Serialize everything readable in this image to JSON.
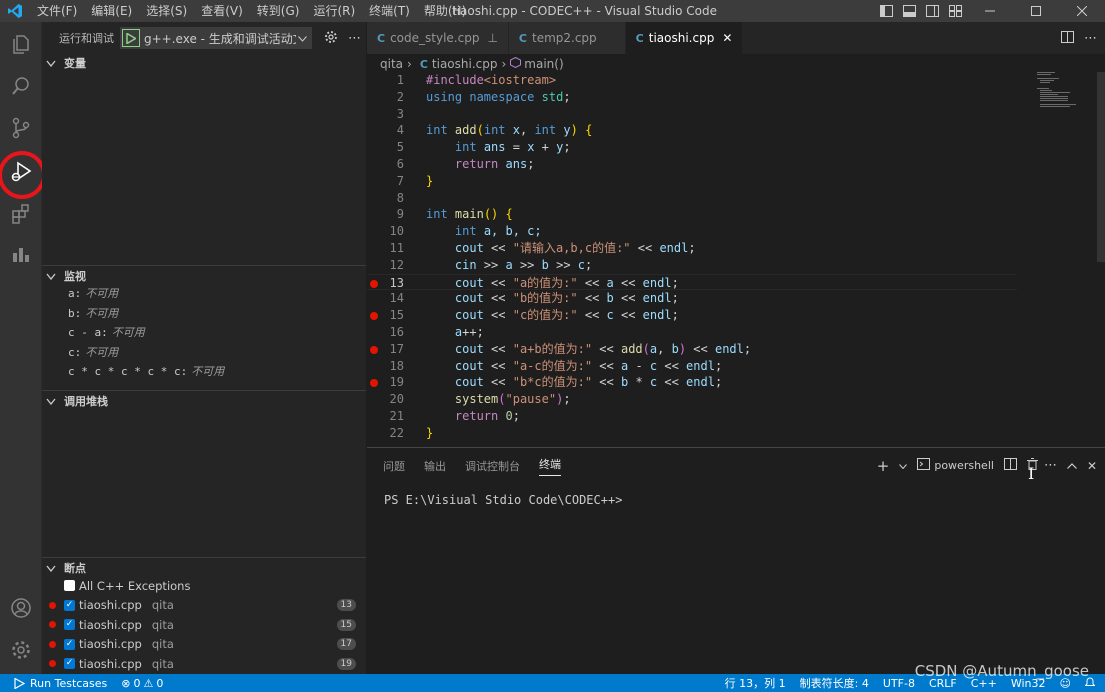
{
  "titlebar": {
    "menu": [
      "文件(F)",
      "编辑(E)",
      "选择(S)",
      "查看(V)",
      "转到(G)",
      "运行(R)",
      "终端(T)",
      "帮助(H)"
    ],
    "title": "tiaoshi.cpp - CODEC++ - Visual Studio Code"
  },
  "sidebar": {
    "header_label": "运行和调试",
    "launch_config": "g++.exe - 生成和调试活动文件",
    "variables_title": "变量",
    "watch_title": "监视",
    "watch": [
      {
        "expr": "a:",
        "value": "不可用"
      },
      {
        "expr": "b:",
        "value": "不可用"
      },
      {
        "expr": "c - a:",
        "value": "不可用"
      },
      {
        "expr": "c:",
        "value": "不可用"
      },
      {
        "expr": "c * c * c * c * c:",
        "value": "不可用"
      }
    ],
    "callstack_title": "调用堆栈",
    "breakpoints_title": "断点",
    "exceptions_label": "All C++ Exceptions",
    "breakpoints": [
      {
        "file": "tiaoshi.cpp",
        "path": "qita",
        "line": "13"
      },
      {
        "file": "tiaoshi.cpp",
        "path": "qita",
        "line": "15"
      },
      {
        "file": "tiaoshi.cpp",
        "path": "qita",
        "line": "17"
      },
      {
        "file": "tiaoshi.cpp",
        "path": "qita",
        "line": "19"
      }
    ]
  },
  "tabs": [
    {
      "label": "code_style.cpp",
      "active": false
    },
    {
      "label": "temp2.cpp",
      "active": false
    },
    {
      "label": "tiaoshi.cpp",
      "active": true
    }
  ],
  "breadcrumb": {
    "folder": "qita",
    "file": "tiaoshi.cpp",
    "symbol": "main()"
  },
  "editor": {
    "lines": [
      "1",
      "2",
      "3",
      "4",
      "5",
      "6",
      "7",
      "8",
      "9",
      "10",
      "11",
      "12",
      "13",
      "14",
      "15",
      "16",
      "17",
      "18",
      "19",
      "20",
      "21",
      "22"
    ],
    "code": {
      "l1a": "#include",
      "l1b": "<iostream>",
      "l2a": "using",
      "l2b": "namespace",
      "l2c": "std",
      "l4a": "int",
      "l4b": "add",
      "l4c": "int",
      "l4d": "x",
      "l4e": "int",
      "l4f": "y",
      "l5a": "int",
      "l5b": "ans",
      "l5c": "x",
      "l5d": "y",
      "l6a": "return",
      "l6b": "ans",
      "l9a": "int",
      "l9b": "main",
      "l10a": "int",
      "l10b": "a, b, c;",
      "l11a": "cout",
      "l11b": "\"请输入a,b,c的值:\"",
      "l11c": "endl",
      "l12a": "cin",
      "l12b": "a",
      "l12c": "b",
      "l12d": "c",
      "l13a": "cout",
      "l13b": "\"a的值为:\"",
      "l13c": "a",
      "l13d": "endl",
      "l14a": "cout",
      "l14b": "\"b的值为:\"",
      "l14c": "b",
      "l14d": "endl",
      "l15a": "cout",
      "l15b": "\"c的值为:\"",
      "l15c": "c",
      "l15d": "endl",
      "l16a": "a",
      "l17a": "cout",
      "l17b": "\"a+b的值为:\"",
      "l17c": "add",
      "l17d": "a",
      "l17e": "b",
      "l17f": "endl",
      "l18a": "cout",
      "l18b": "\"a-c的值为:\"",
      "l18c": "a",
      "l18d": "c",
      "l18e": "endl",
      "l19a": "cout",
      "l19b": "\"b*c的值为:\"",
      "l19c": "b",
      "l19d": "c",
      "l19e": "endl",
      "l20a": "system",
      "l20b": "\"pause\"",
      "l21a": "return",
      "l21b": "0"
    }
  },
  "panel": {
    "tabs": [
      "问题",
      "输出",
      "调试控制台",
      "终端"
    ],
    "shell": "powershell",
    "terminal_text": "PS E:\\Visiual Stdio Code\\CODEC++>"
  },
  "statusbar": {
    "run_testcases": "Run Testcases",
    "errors": "0",
    "warnings": "0",
    "position": "行 13，列 1",
    "tab_size": "制表符长度: 4",
    "encoding": "UTF-8",
    "eol": "CRLF",
    "language": "C++",
    "platform": "Win32"
  },
  "watermark": "CSDN @Autumn_goose",
  "colors": {
    "accent": "#007acc",
    "breakpoint": "#e51400",
    "highlight_circle": "#e8151b"
  }
}
